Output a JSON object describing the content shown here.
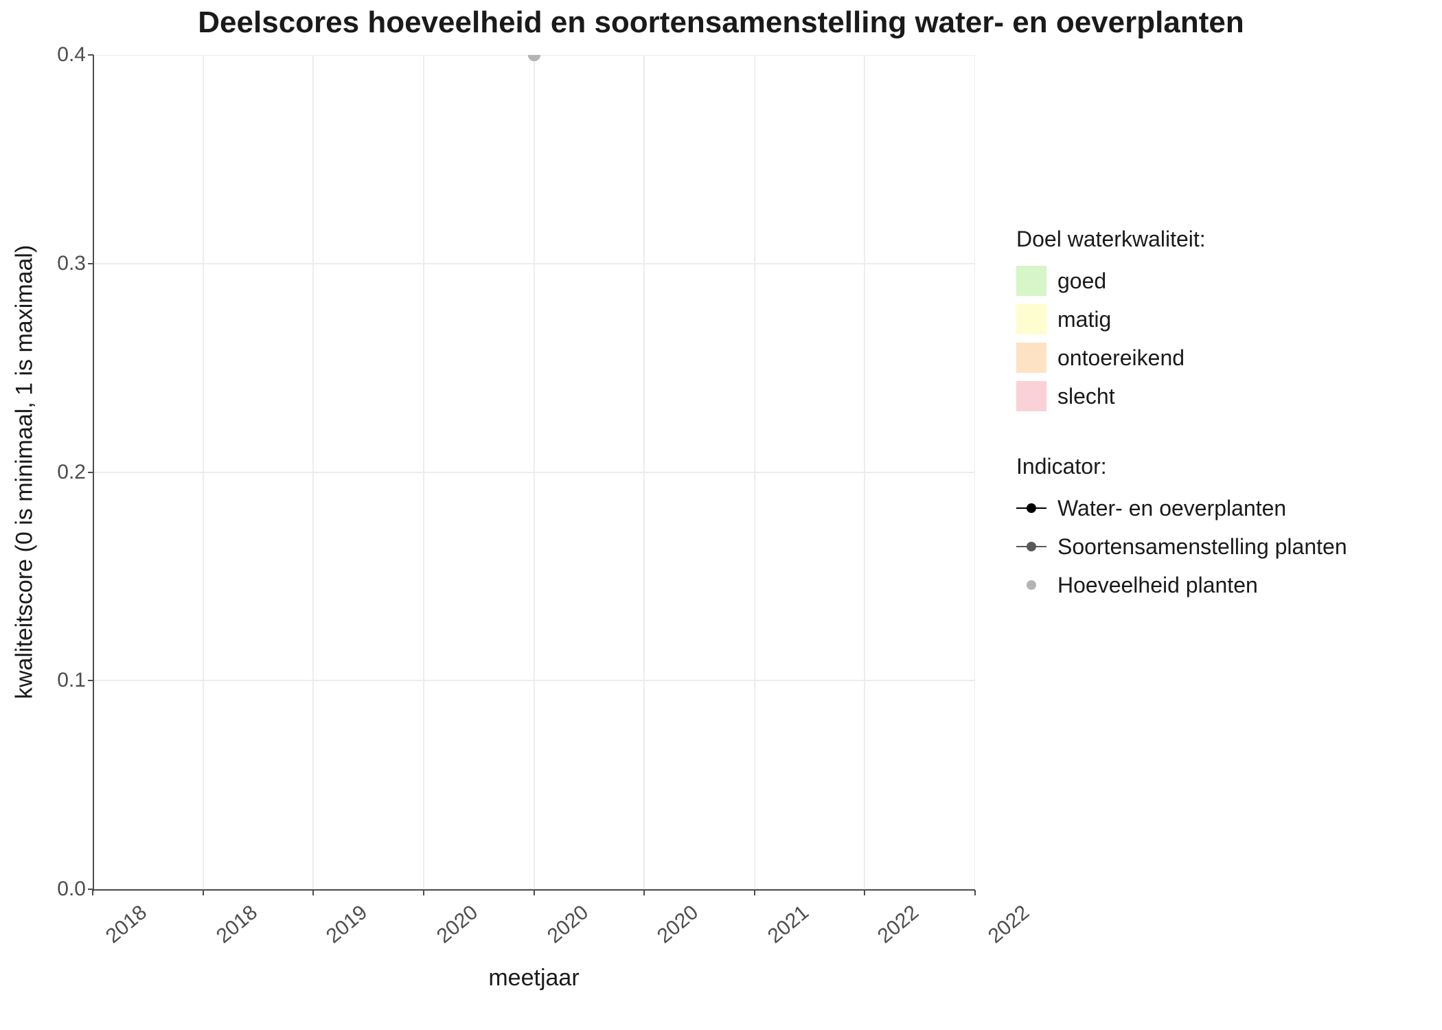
{
  "chart_data": {
    "type": "scatter",
    "title": "Deelscores hoeveelheid en soortensamenstelling water- en oeverplanten",
    "xlabel": "meetjaar",
    "ylabel": "kwaliteitscore (0 is minimaal, 1 is maximaal)",
    "xlim": [
      2017.6,
      2022.4
    ],
    "ylim": [
      0.0,
      0.4
    ],
    "x_ticks": [
      "2018",
      "2018",
      "2019",
      "2020",
      "2020",
      "2020",
      "2021",
      "2022",
      "2022"
    ],
    "x_tick_positions": [
      2017.6,
      2018.2,
      2018.8,
      2019.4,
      2020.0,
      2020.6,
      2021.2,
      2021.8,
      2022.4
    ],
    "y_ticks": [
      "0.0",
      "0.1",
      "0.2",
      "0.3",
      "0.4"
    ],
    "y_tick_values": [
      0.0,
      0.1,
      0.2,
      0.3,
      0.4
    ],
    "series": [
      {
        "name": "Water- en oeverplanten",
        "color": "#000000",
        "points": []
      },
      {
        "name": "Soortensamenstelling planten",
        "color": "#595959",
        "points": [
          {
            "x": 2020.0,
            "y": 0.4
          }
        ]
      },
      {
        "name": "Hoeveelheid planten",
        "color": "#b4b4b4",
        "points": [
          {
            "x": 2020.0,
            "y": 0.4
          }
        ]
      }
    ],
    "legends": {
      "quality": {
        "title": "Doel waterkwaliteit:",
        "items": [
          {
            "label": "goed",
            "color": "#d6f5c9"
          },
          {
            "label": "matig",
            "color": "#fdfdd0"
          },
          {
            "label": "ontoereikend",
            "color": "#fde3c4"
          },
          {
            "label": "slecht",
            "color": "#fad1d6"
          }
        ]
      },
      "indicator": {
        "title": "Indicator:",
        "items": [
          {
            "label": "Water- en oeverplanten",
            "color": "#000000",
            "has_line": true
          },
          {
            "label": "Soortensamenstelling planten",
            "color": "#595959",
            "has_line": true
          },
          {
            "label": "Hoeveelheid planten",
            "color": "#b4b4b4",
            "has_line": false
          }
        ]
      }
    }
  }
}
